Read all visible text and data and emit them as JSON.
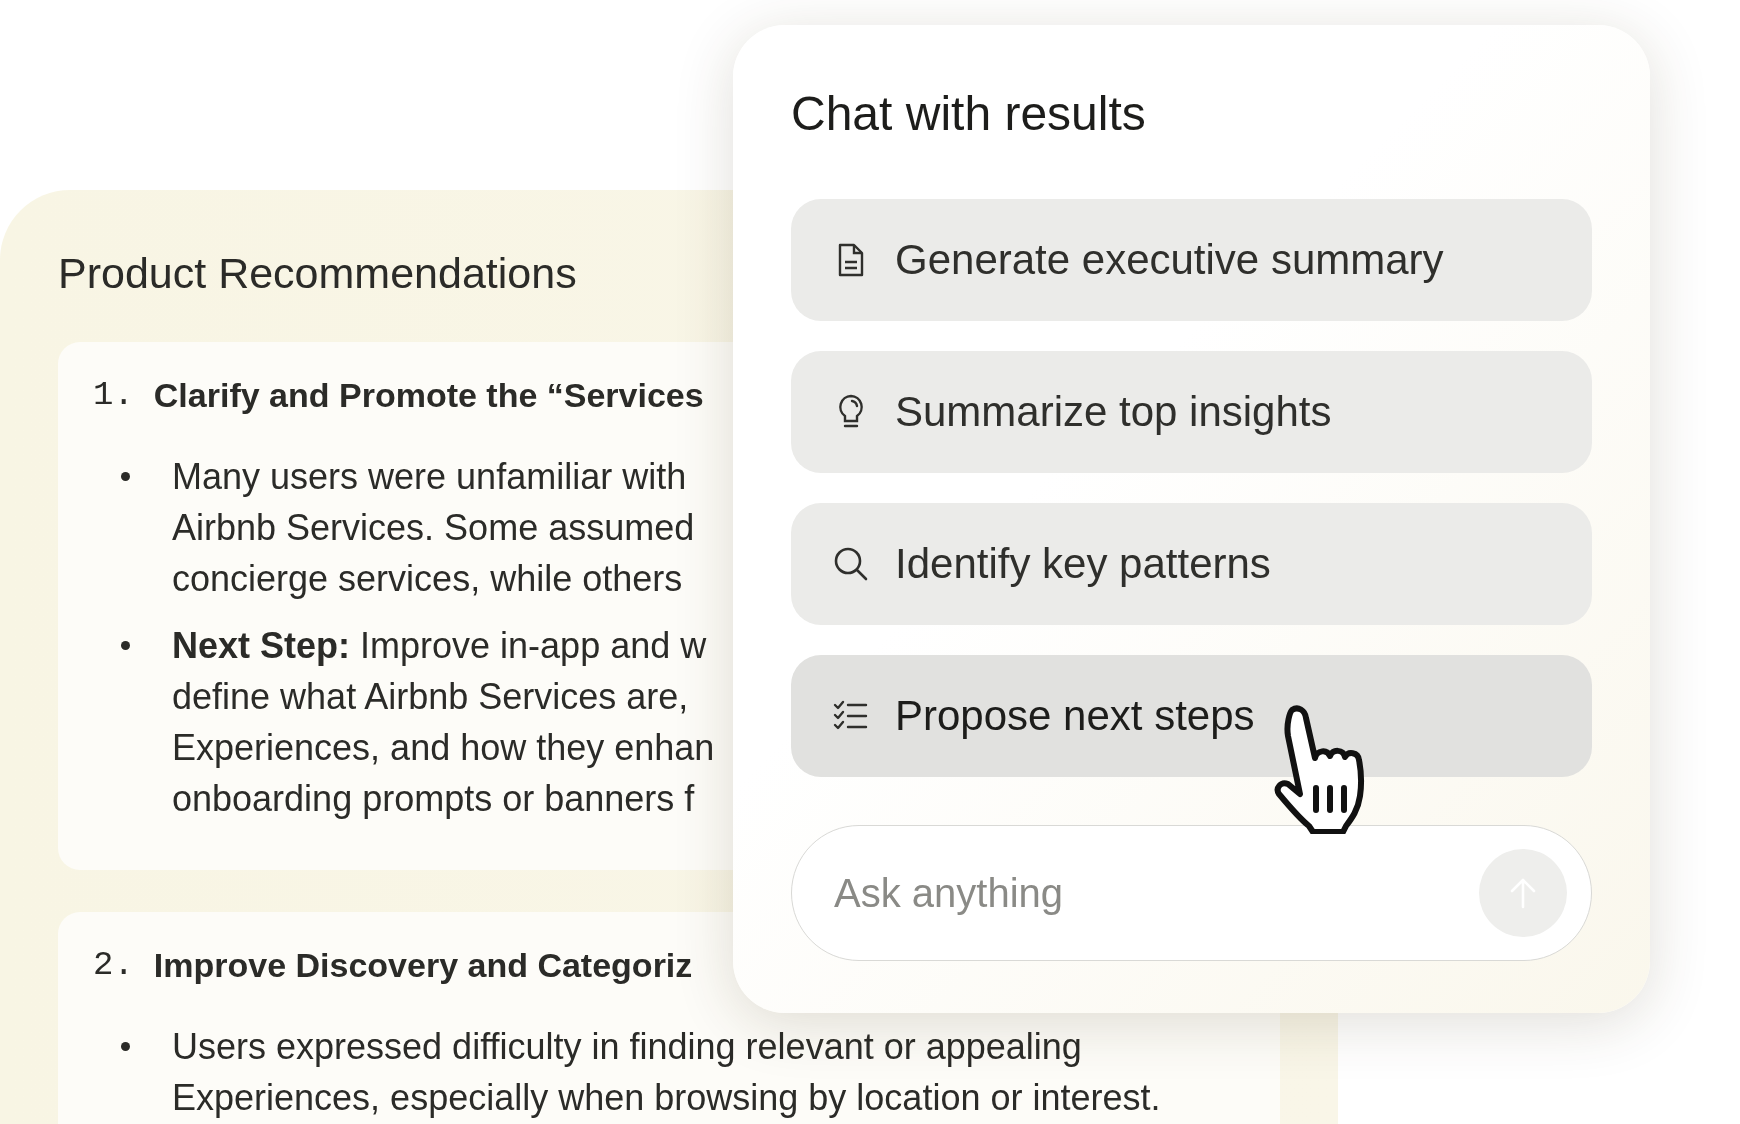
{
  "report": {
    "title": "Product Recommendations",
    "sections": [
      {
        "number": "1.",
        "heading": "Clarify and Promote the “Services",
        "bullets": [
          {
            "lines": [
              "Many users were unfamiliar with",
              "Airbnb Services. Some assumed",
              "concierge services, while others"
            ]
          },
          {
            "lines": [
              "**Next Step:** Improve in-app and w",
              "define what Airbnb Services are,",
              "Experiences, and how they enhan",
              "onboarding prompts or banners f"
            ]
          }
        ]
      },
      {
        "number": "2.",
        "heading": "Improve Discovery and Categoriz",
        "bullets": [
          {
            "lines": [
              "Users expressed difficulty in finding relevant or appealing",
              "Experiences, especially when browsing by location or interest."
            ]
          }
        ]
      }
    ]
  },
  "chat": {
    "title": "Chat with results",
    "suggestions": [
      {
        "label": "Generate executive summary",
        "hovered": false
      },
      {
        "label": "Summarize top insights",
        "hovered": false
      },
      {
        "label": "Identify key patterns",
        "hovered": false
      },
      {
        "label": "Propose next steps",
        "hovered": true
      }
    ],
    "input": {
      "placeholder": "Ask anything"
    },
    "send": {
      "disabled": true
    }
  }
}
